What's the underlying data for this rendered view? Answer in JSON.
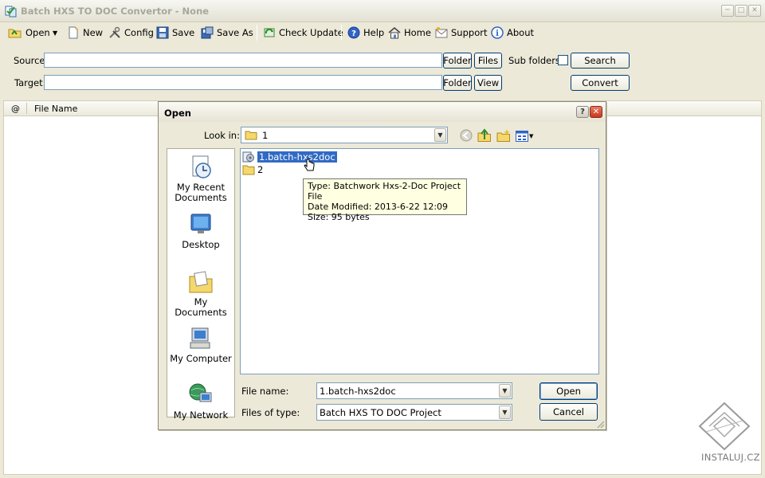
{
  "window": {
    "title": "Batch HXS TO DOC Convertor - None",
    "caption_buttons": [
      "minimize",
      "maximize",
      "close"
    ]
  },
  "toolbar": {
    "open_label": "Open",
    "new_label": "New",
    "config_label": "Config",
    "save_label": "Save",
    "save_as_label": "Save As",
    "check_update_label": "Check Update",
    "help_label": "Help",
    "home_label": "Home",
    "support_label": "Support",
    "about_label": "About"
  },
  "paths": {
    "source_label": "Source",
    "source_value": "",
    "target_label": "Target",
    "target_value": "",
    "folder_label": "Folder",
    "files_label": "Files",
    "view_label": "View",
    "subfolders_label": "Sub folders",
    "subfolders_checked": false,
    "search_label": "Search",
    "convert_label": "Convert"
  },
  "list": {
    "columns": [
      "@",
      "File Name"
    ]
  },
  "dialog": {
    "title": "Open",
    "look_in_label": "Look in:",
    "look_in_value": "1",
    "places": [
      {
        "label": "My Recent Documents"
      },
      {
        "label": "Desktop"
      },
      {
        "label": "My Documents"
      },
      {
        "label": "My Computer"
      },
      {
        "label": "My Network"
      }
    ],
    "files": [
      {
        "name": "1.batch-hxs2doc",
        "type": "project",
        "selected": true
      },
      {
        "name": "2",
        "type": "folder",
        "selected": false
      }
    ],
    "tooltip": {
      "line1": "Type: Batchwork Hxs-2-Doc Project File",
      "line2": "Date Modified: 2013-6-22 12:09",
      "line3": "Size: 95 bytes"
    },
    "file_name_label": "File name:",
    "file_name_value": "1.batch-hxs2doc",
    "files_of_type_label": "Files of type:",
    "files_of_type_value": "Batch HXS TO DOC Project",
    "open_button": "Open",
    "cancel_button": "Cancel"
  },
  "watermark": {
    "text": "INSTALUJ.CZ"
  },
  "colors": {
    "dialog_face": "#ece9d8",
    "selection": "#316ac5",
    "tooltip_bg": "#ffffe1",
    "close_red": "#d9462e"
  }
}
